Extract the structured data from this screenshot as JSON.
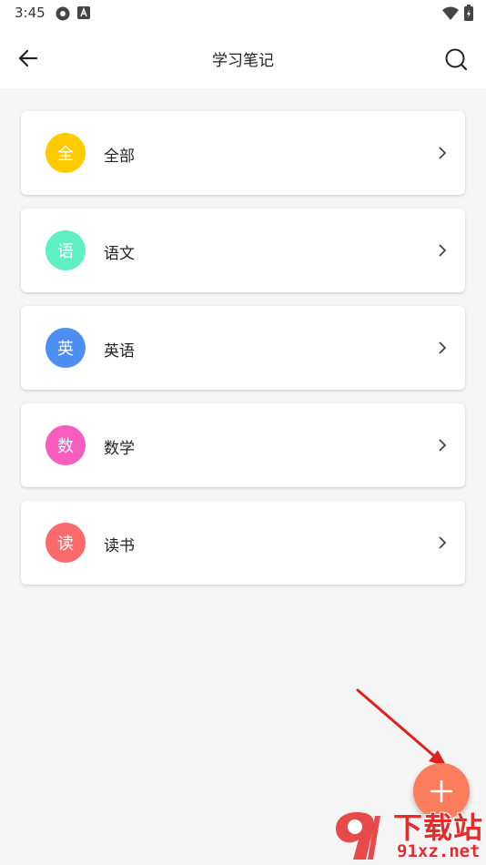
{
  "status_bar": {
    "time": "3:45",
    "icons": [
      "settings-gear-icon",
      "keyboard-a-icon",
      "wifi-icon",
      "battery-charging-icon"
    ]
  },
  "app_bar": {
    "title": "学习笔记",
    "back_icon": "back-arrow-icon",
    "search_icon": "search-icon"
  },
  "categories": [
    {
      "badge": "全",
      "label": "全部",
      "color": "#fecb00"
    },
    {
      "badge": "语",
      "label": "语文",
      "color": "#5ef0c2"
    },
    {
      "badge": "英",
      "label": "英语",
      "color": "#4d8ef2"
    },
    {
      "badge": "数",
      "label": "数学",
      "color": "#f75dbe"
    },
    {
      "badge": "读",
      "label": "读书",
      "color": "#fc6a6c"
    }
  ],
  "fab": {
    "icon": "plus-icon",
    "color": "#fb7d5c"
  },
  "watermark": {
    "brand_cn": "下载站",
    "brand_en": "91xz.net"
  },
  "colors": {
    "app_bar_bg": "#ffffff",
    "page_bg": "#f5f5f5",
    "annotation_arrow": "#e02020"
  }
}
